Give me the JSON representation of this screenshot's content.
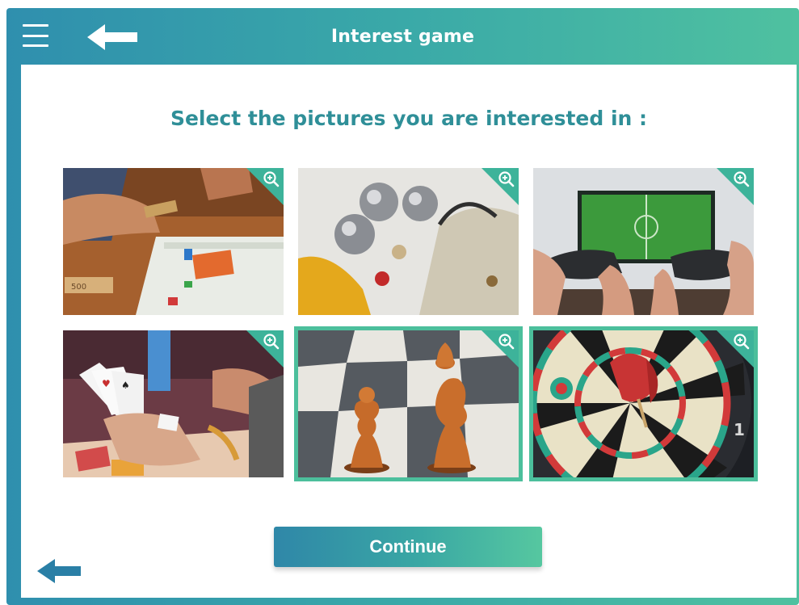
{
  "header": {
    "title": "Interest game",
    "menu_icon": "hamburger-menu-icon",
    "back_icon": "arrow-left-icon"
  },
  "prompt": "Select the pictures you are interested in :",
  "tiles": [
    {
      "subject": "board-game",
      "selected": false
    },
    {
      "subject": "petanque-balls",
      "selected": false
    },
    {
      "subject": "video-game",
      "selected": false
    },
    {
      "subject": "playing-cards",
      "selected": false
    },
    {
      "subject": "chess",
      "selected": true
    },
    {
      "subject": "darts",
      "selected": true
    }
  ],
  "continue_label": "Continue",
  "colors": {
    "header_gradient_start": "#2f8fae",
    "header_gradient_end": "#4fc1a0",
    "prompt_text": "#2f8f98",
    "selection_border": "#4cbf9c",
    "bottom_back_arrow": "#2a7fa6"
  }
}
